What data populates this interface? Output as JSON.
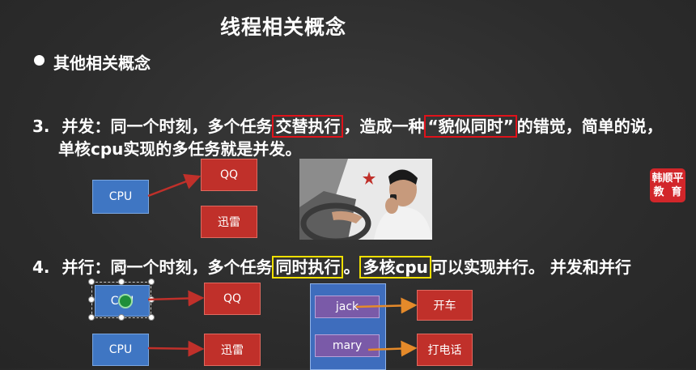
{
  "slide": {
    "title": "线程相关概念",
    "bullet": "其他相关概念",
    "item3": {
      "num": "3.",
      "p1": "并发：同一个时刻，多个任务",
      "hl1": "交替执行",
      "p2": "，造成一种",
      "hl2": "“貌似同时”",
      "p3": "的错觉，简单的说，",
      "line2": "单核cpu实现的多任务就是并发。"
    },
    "item4": {
      "num": "4.",
      "p1": "并行：同一个时刻，多个任务",
      "hl1": "同时执行",
      "p2": "。",
      "hl2": "多核cpu",
      "p3": "可以实现并行。 并发和并行"
    },
    "diagram1": {
      "cpu": "CPU",
      "task1": "QQ",
      "task2": "迅雷"
    },
    "diagram2": {
      "cpu1": "CPU",
      "cpu2": "CPU",
      "task1": "QQ",
      "task2": "迅雷"
    },
    "diagram3": {
      "person1": "jack",
      "person2": "mary",
      "action1": "开车",
      "action2": "打电话"
    },
    "logo": {
      "line1": "韩顺平",
      "line2": "教  育"
    },
    "colors": {
      "highlight_red": "#e0121a",
      "highlight_yellow": "#f0e000",
      "cpu_blue": "#3f76c3",
      "task_red": "#c0302a"
    }
  }
}
